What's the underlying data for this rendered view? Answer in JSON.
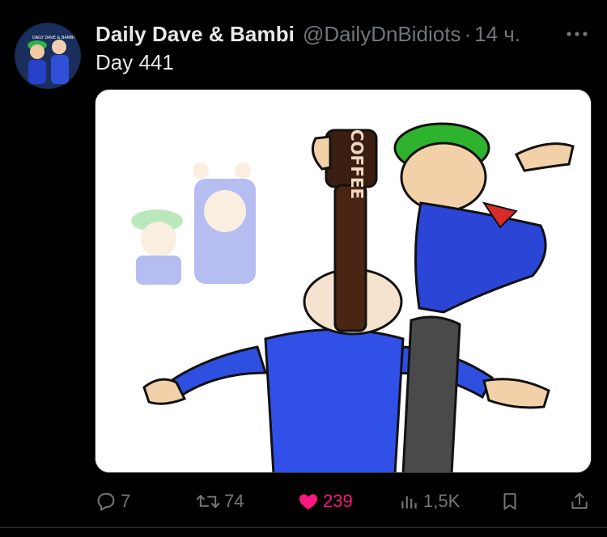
{
  "author": {
    "display_name": "Daily Dave & Bambi",
    "handle": "@DailyDnBidiots",
    "separator": "·",
    "time": "14 ч.",
    "avatar_text": "DAILY DAVE & BAMBI"
  },
  "tweet": {
    "text": "Day 441"
  },
  "media": {
    "bottle_label": "COFFEE"
  },
  "actions": {
    "reply": {
      "icon": "reply-icon",
      "count": "7"
    },
    "repost": {
      "icon": "repost-icon",
      "count": "74"
    },
    "like": {
      "icon": "heart-filled-icon",
      "count": "239",
      "active": true,
      "color": "#f91880"
    },
    "views": {
      "icon": "views-icon",
      "count": "1,5K"
    },
    "bookmark": {
      "icon": "bookmark-icon"
    },
    "share": {
      "icon": "share-icon"
    }
  },
  "colors": {
    "background": "#000000",
    "primary_text": "#e7e9ea",
    "secondary_text": "#71767b",
    "like": "#f91880"
  }
}
